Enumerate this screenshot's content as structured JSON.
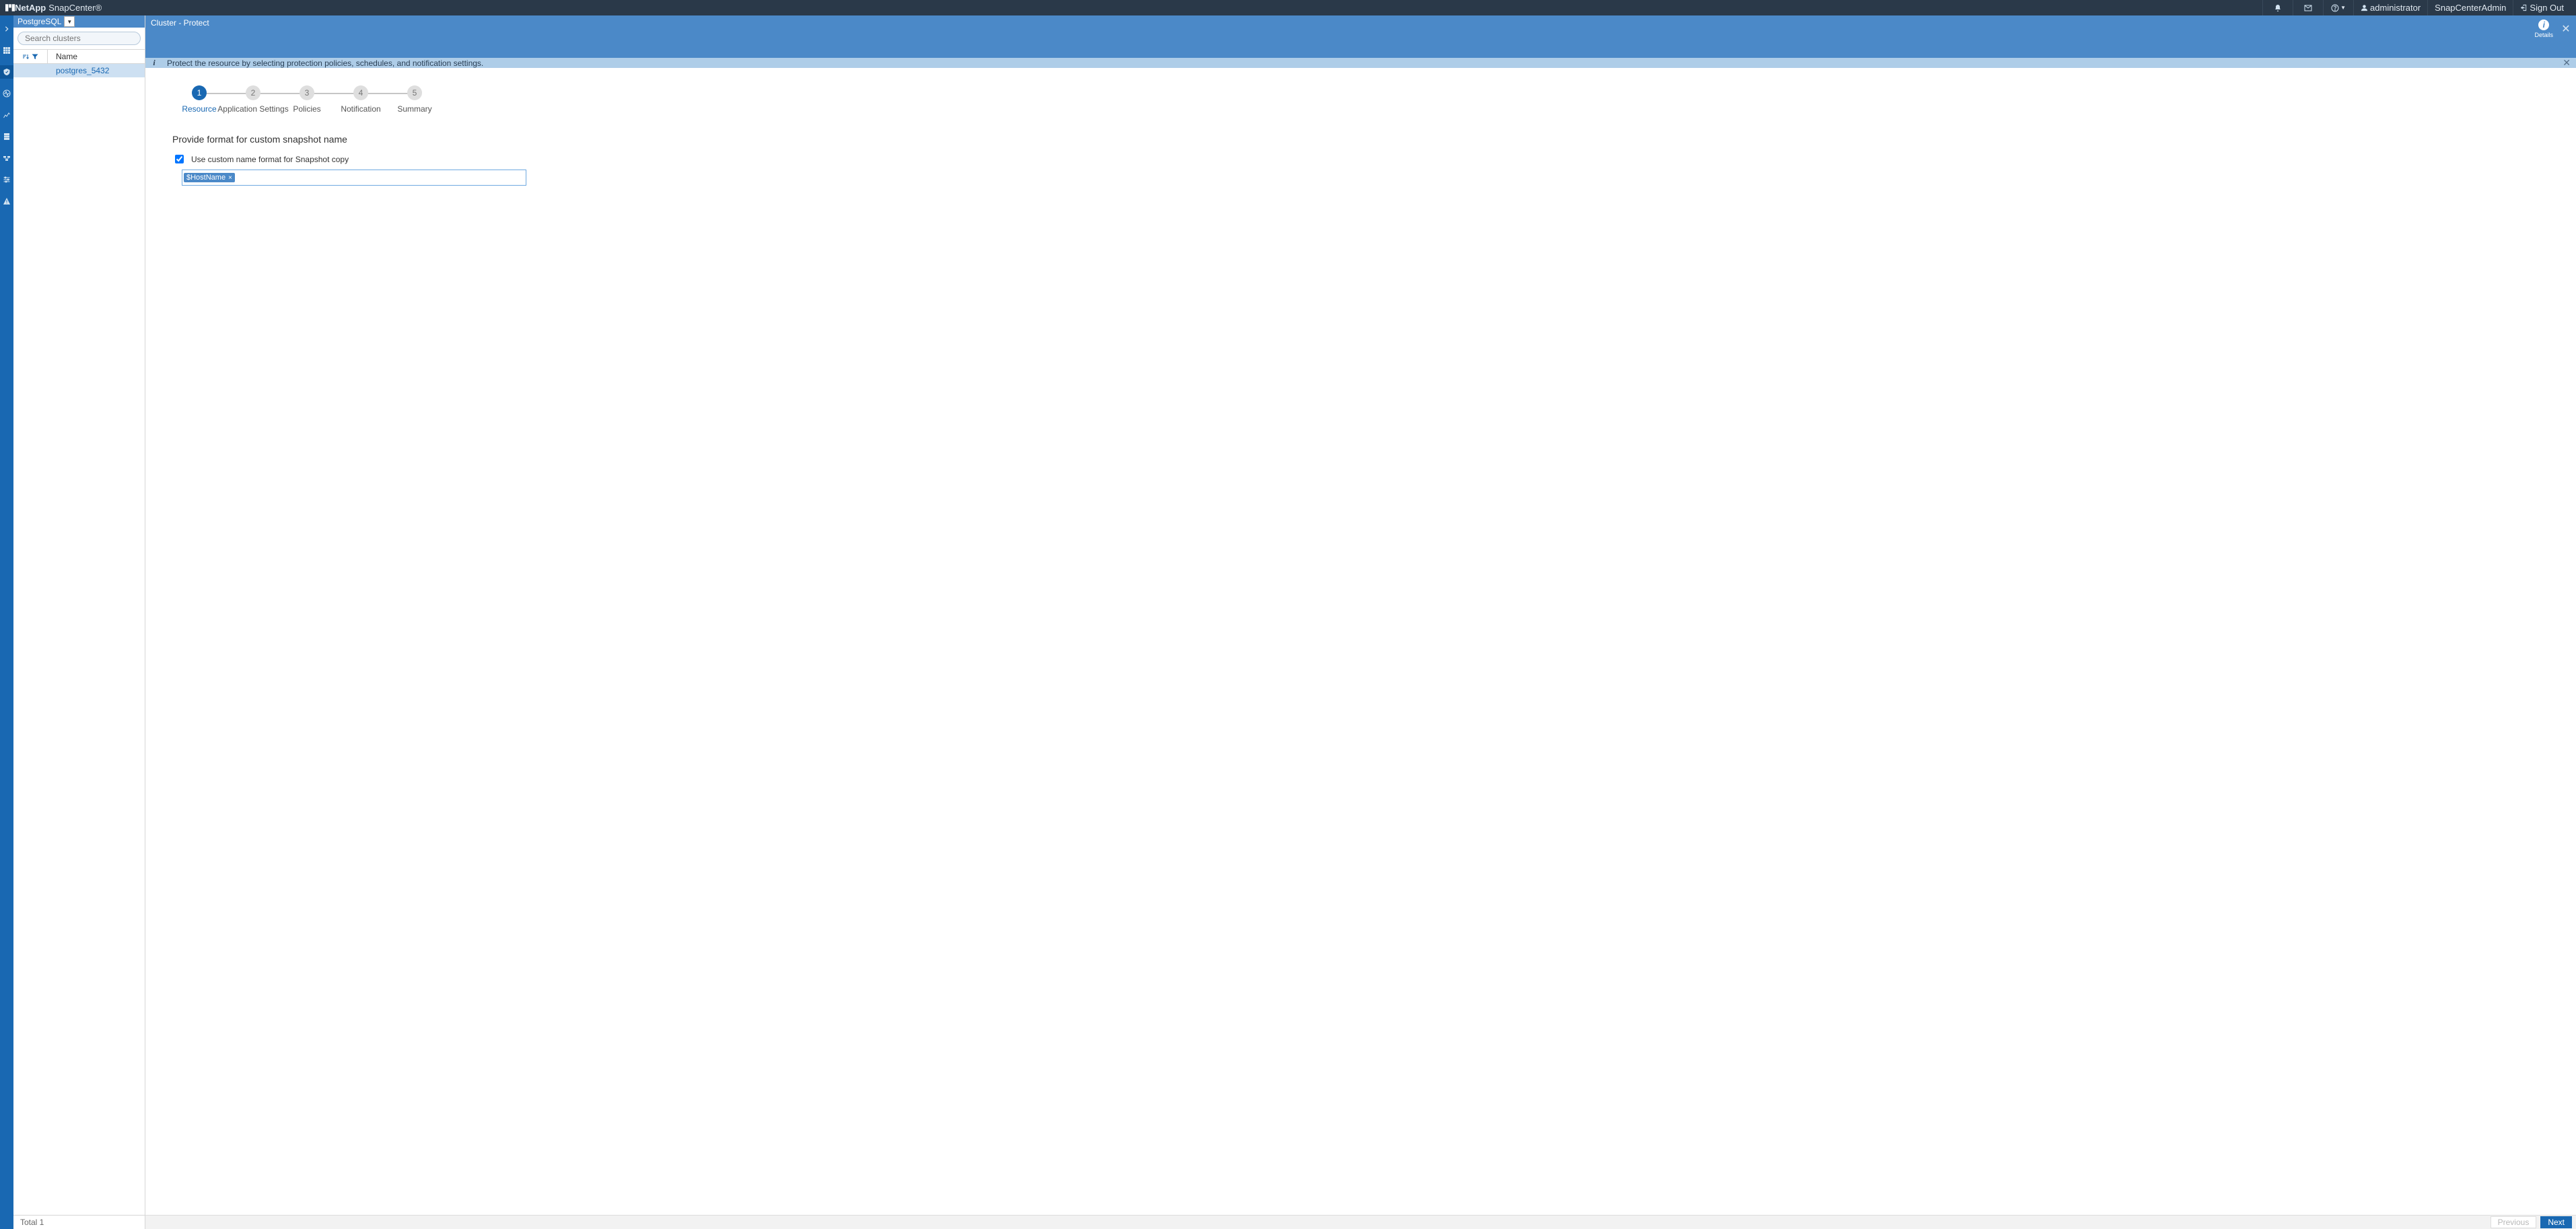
{
  "header": {
    "brand_prefix": "NetApp",
    "brand_name": "SnapCenter®",
    "user_label": "administrator",
    "tenant_label": "SnapCenterAdmin",
    "signout_label": "Sign Out"
  },
  "left_panel": {
    "context": "PostgreSQL",
    "search_placeholder": "Search clusters",
    "col_name": "Name",
    "rows": [
      {
        "name": "postgres_5432"
      }
    ],
    "footer_total": "Total 1"
  },
  "content": {
    "breadcrumb": "Cluster - Protect",
    "details_label": "Details",
    "info_text": "Protect the resource by selecting protection policies, schedules, and notification settings."
  },
  "wizard": {
    "steps": [
      {
        "num": "1",
        "label": "Resource",
        "active": true
      },
      {
        "num": "2",
        "label": "Application Settings",
        "active": false
      },
      {
        "num": "3",
        "label": "Policies",
        "active": false
      },
      {
        "num": "4",
        "label": "Notification",
        "active": false
      },
      {
        "num": "5",
        "label": "Summary",
        "active": false
      }
    ],
    "section_title": "Provide format for custom snapshot name",
    "checkbox_label": "Use custom name format for Snapshot copy",
    "checkbox_checked": true,
    "tags": [
      {
        "text": "$HostName"
      }
    ]
  },
  "footer": {
    "prev": "Previous",
    "next": "Next"
  }
}
